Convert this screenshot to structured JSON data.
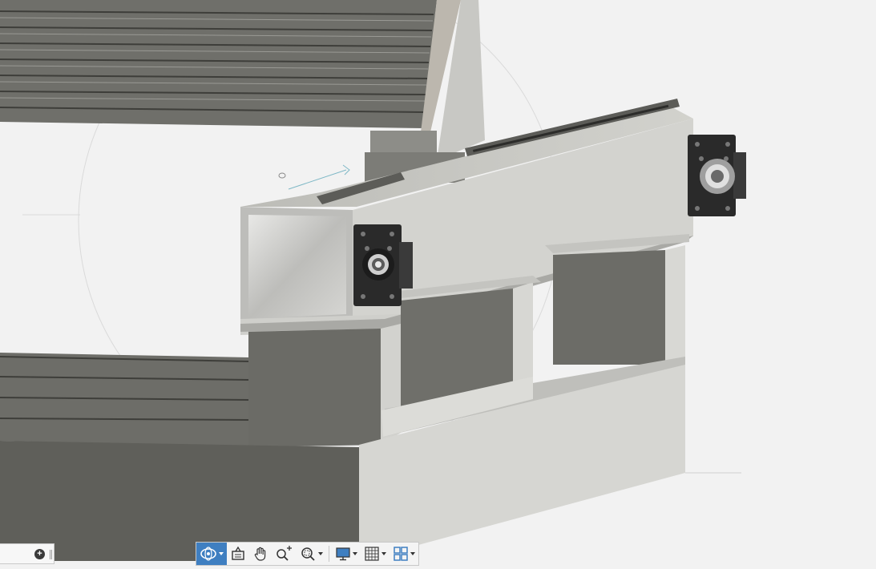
{
  "viewport": {
    "background": "#f2f2f2",
    "model_colors": {
      "gray_dark": "#6c6c66",
      "gray_light": "#d5d5d1",
      "gray_mid": "#9c9c97",
      "bracket_black": "#2a2a2a",
      "beam_face": "#d9d9d5"
    }
  },
  "comments_panel": {
    "add_icon": "plus-circle-icon",
    "grip_icon": "panel-grip-icon"
  },
  "navigation_bar": {
    "tools": [
      {
        "icon": "orbit-icon",
        "has_dropdown": true,
        "active": true
      },
      {
        "icon": "look-at-icon",
        "has_dropdown": false,
        "active": false
      },
      {
        "icon": "pan-hand-icon",
        "has_dropdown": false,
        "active": false
      },
      {
        "icon": "zoom-icon",
        "has_dropdown": false,
        "active": false
      },
      {
        "icon": "fit-window-icon",
        "has_dropdown": true,
        "active": false
      }
    ],
    "display": [
      {
        "icon": "display-settings-icon",
        "has_dropdown": true
      },
      {
        "icon": "grid-snaps-icon",
        "has_dropdown": true
      },
      {
        "icon": "viewports-icon",
        "has_dropdown": true
      }
    ],
    "accent_color": "#3f7fc1"
  }
}
